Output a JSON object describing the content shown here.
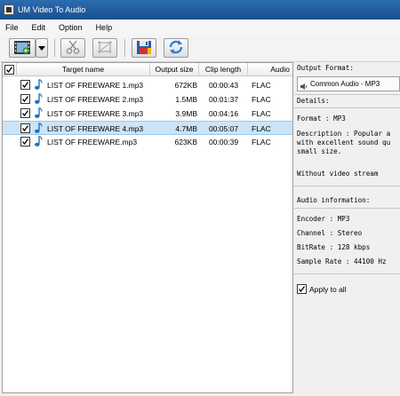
{
  "window": {
    "title": "UM Video To Audio"
  },
  "menu": [
    "File",
    "Edit",
    "Option",
    "Help"
  ],
  "toolbar": {
    "buttons": [
      "add-video-icon",
      "dropdown-arrow-icon",
      "cut-icon",
      "crop-icon",
      "save-icon",
      "convert-icon"
    ]
  },
  "list": {
    "columns": [
      "Target name",
      "Output size",
      "Clip length",
      "Audio"
    ],
    "rows": [
      {
        "name": "LIST OF FREEWARE 1.mp3",
        "size": "672KB",
        "length": "00:00:43",
        "audio": "FLAC",
        "checked": true,
        "selected": false
      },
      {
        "name": "LIST OF FREEWARE 2.mp3",
        "size": "1.5MB",
        "length": "00:01:37",
        "audio": "FLAC",
        "checked": true,
        "selected": false
      },
      {
        "name": "LIST OF FREEWARE 3.mp3",
        "size": "3.9MB",
        "length": "00:04:16",
        "audio": "FLAC",
        "checked": true,
        "selected": false
      },
      {
        "name": "LIST OF FREEWARE 4.mp3",
        "size": "4.7MB",
        "length": "00:05:07",
        "audio": "FLAC",
        "checked": true,
        "selected": true
      },
      {
        "name": "LIST OF FREEWARE.mp3",
        "size": "623KB",
        "length": "00:00:39",
        "audio": "FLAC",
        "checked": true,
        "selected": false
      }
    ]
  },
  "details": {
    "output_format_label": "Output Format:",
    "output_format_value": "Common Audio - MP3",
    "details_label": "Details:",
    "format_line": "Format      : MP3",
    "description_line1": "Description : Popular a",
    "description_line2": "with excellent sound qu",
    "description_line3": "small size.",
    "without_video": "Without video stream",
    "audio_info_label": "Audio information:",
    "encoder_line": "Encoder     : MP3",
    "channel_line": "Channel     : Stereo",
    "bitrate_line": "BitRate     : 128 kbps",
    "samplerate_line": "Sample Rate : 44100 Hz",
    "apply_all_label": "Apply to all",
    "apply_all_checked": true
  },
  "colors": {
    "title_bar": "#1b4f8f",
    "selected_row": "#cce4f7",
    "music_note": "#1e73be"
  }
}
